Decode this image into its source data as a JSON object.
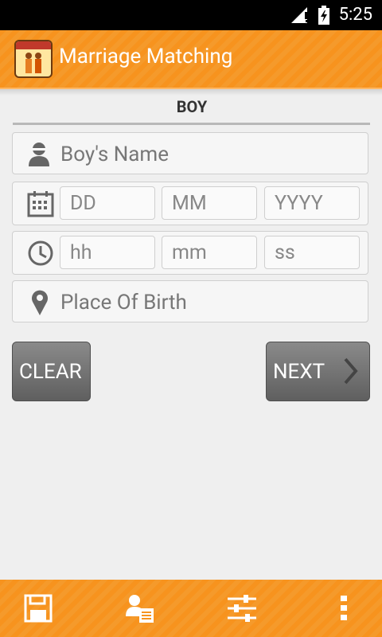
{
  "status_bar": {
    "time": "5:25"
  },
  "app": {
    "title": "Marriage Matching"
  },
  "form": {
    "section_title": "BOY",
    "name_placeholder": "Boy's Name",
    "date": {
      "day": "DD",
      "month": "MM",
      "year": "YYYY"
    },
    "time": {
      "hour": "hh",
      "minute": "mm",
      "second": "ss"
    },
    "place_placeholder": "Place Of Birth"
  },
  "buttons": {
    "clear": "CLEAR",
    "next": "NEXT"
  },
  "bottom_bar": {
    "icons": [
      "save-icon",
      "profile-list-icon",
      "sliders-icon",
      "overflow-menu-icon"
    ]
  },
  "colors": {
    "accent": "#f7931e",
    "button": "#707070"
  }
}
